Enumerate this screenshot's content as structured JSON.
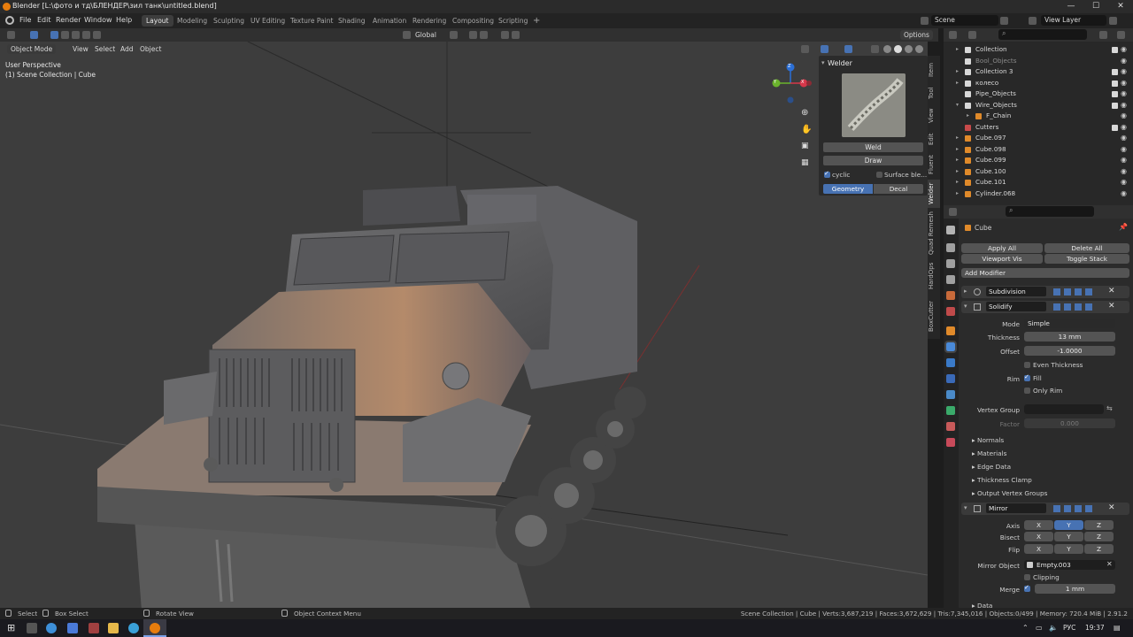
{
  "window": {
    "title": "Blender [L:\\фото и тд\\БЛЕНДЕР\\зил танк\\untitled.blend]",
    "minimize": "—",
    "maximize": "☐",
    "close": "✕"
  },
  "menu": [
    "File",
    "Edit",
    "Render",
    "Window",
    "Help"
  ],
  "workspaces": [
    "Layout",
    "Modeling",
    "Sculpting",
    "UV Editing",
    "Texture Paint",
    "Shading",
    "Animation",
    "Rendering",
    "Compositing",
    "Scripting"
  ],
  "add_workspace": "+",
  "scene": "Scene",
  "view_layer": "View Layer",
  "viewport_header": {
    "mode": "Object Mode",
    "menus": [
      "View",
      "Select",
      "Add",
      "Object"
    ],
    "orientation": "Global",
    "options": "Options"
  },
  "viewport_info": {
    "perspective": "User Perspective",
    "collection": "(1) Scene Collection | Cube"
  },
  "gizmo": {
    "x": "X",
    "y": "Y",
    "z": "Z"
  },
  "welder_panel": {
    "title": "Welder",
    "weld_button": "Weld",
    "draw_button": "Draw",
    "cyclic_label": "cyclic",
    "surface_label": "Surface ble...",
    "tab_geometry": "Geometry",
    "tab_decal": "Decal"
  },
  "side_tabs": [
    "Item",
    "Tool",
    "View",
    "Edit",
    "Fluent",
    "Welder",
    "Quad Remesh",
    "HardOps",
    "BoxCutter"
  ],
  "outliner": [
    {
      "label": "Collection",
      "color": "#d8d8d8",
      "arrow": "▸",
      "checked": true
    },
    {
      "label": "Bool_Objects",
      "color": "#8a8a8a",
      "arrow": "",
      "checked": false
    },
    {
      "label": "Collection 3",
      "color": "#d8d8d8",
      "arrow": "▸",
      "checked": true
    },
    {
      "label": "колесо",
      "color": "#d8d8d8",
      "arrow": "▸",
      "checked": true
    },
    {
      "label": "Pipe_Objects",
      "color": "#d8d8d8",
      "arrow": "",
      "checked": true
    },
    {
      "label": "Wire_Objects",
      "color": "#d8d8d8",
      "arrow": "▾",
      "checked": true
    },
    {
      "label": "F_Chain",
      "color": "#d8d8d8",
      "arrow": "▸",
      "checked": false
    },
    {
      "label": "Cutters",
      "color": "#d8d8d8",
      "arrow": "",
      "checked": true
    },
    {
      "label": "Cube.097",
      "color": "#d8d8d8",
      "arrow": "▸",
      "checked": false
    },
    {
      "label": "Cube.098",
      "color": "#d8d8d8",
      "arrow": "▸",
      "checked": false
    },
    {
      "label": "Cube.099",
      "color": "#d8d8d8",
      "arrow": "▸",
      "checked": false
    },
    {
      "label": "Cube.100",
      "color": "#d8d8d8",
      "arrow": "▸",
      "checked": false
    },
    {
      "label": "Cube.101",
      "color": "#d8d8d8",
      "arrow": "▸",
      "checked": false
    },
    {
      "label": "Cylinder.068",
      "color": "#d8d8d8",
      "arrow": "▸",
      "checked": false
    }
  ],
  "properties": {
    "object_name": "Cube",
    "apply_all": "Apply All",
    "delete_all": "Delete All",
    "viewport_vis": "Viewport Vis",
    "toggle_stack": "Toggle Stack",
    "add_modifier": "Add Modifier",
    "subdivision": "Subdivision",
    "solidify": "Solidify",
    "mode_label": "Mode",
    "mode_value": "Simple",
    "thickness_label": "Thickness",
    "thickness_value": "13 mm",
    "offset_label": "Offset",
    "offset_value": "-1.0000",
    "even_thickness": "Even Thickness",
    "rim_label": "Rim",
    "fill": "Fill",
    "only_rim": "Only Rim",
    "vertex_group_label": "Vertex Group",
    "factor_label": "Factor",
    "factor_value": "0.000",
    "subpanels": [
      "Normals",
      "Materials",
      "Edge Data",
      "Thickness Clamp",
      "Output Vertex Groups"
    ],
    "mirror": "Mirror",
    "axis_label": "Axis",
    "bisect_label": "Bisect",
    "flip_label": "Flip",
    "xyz": [
      "X",
      "Y",
      "Z"
    ],
    "mirror_object_label": "Mirror Object",
    "mirror_object_value": "Empty.003",
    "clipping": "Clipping",
    "merge_label": "Merge",
    "merge_value": "1 mm",
    "data": "Data"
  },
  "status": {
    "select": "Select",
    "box_select": "Box Select",
    "rotate_view": "Rotate View",
    "context_menu": "Object Context Menu",
    "stats": "Scene Collection | Cube | Verts:3,687,219 | Faces:3,672,629 | Tris:7,345,016 | Objects:0/499 | Memory: 720.4 MiB | 2.91.2"
  },
  "taskbar": {
    "lang": "РУС",
    "time": "19:37"
  }
}
